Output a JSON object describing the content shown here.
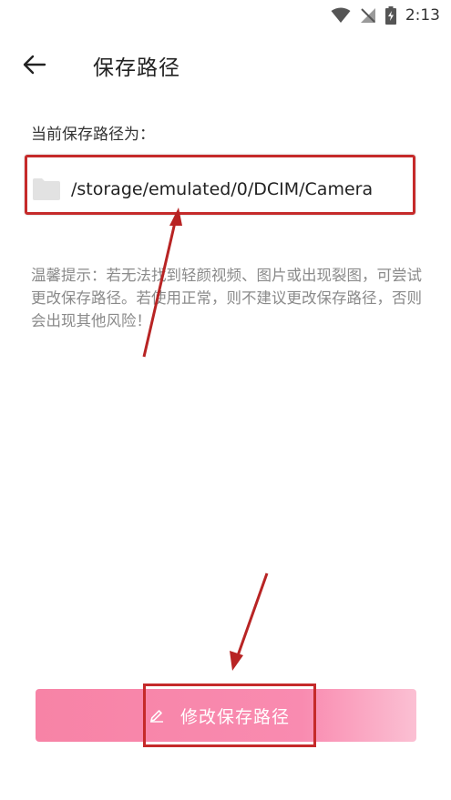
{
  "status_bar": {
    "time": "2:13",
    "icons": [
      "wifi-icon",
      "signal-off-icon",
      "battery-charging-icon"
    ]
  },
  "header": {
    "back_icon": "arrow-left-icon",
    "title": "保存路径"
  },
  "path_section": {
    "label": "当前保存路径为：",
    "folder_icon": "folder-icon",
    "path": "/storage/emulated/0/DCIM/Camera"
  },
  "tip": "温馨提示：若无法找到轻颜视频、图片或出现裂图，可尝试更改保存路径。若使用正常，则不建议更改保存路径，否则会出现其他风险！",
  "modify_button": {
    "icon": "edit-icon",
    "label": "修改保存路径"
  },
  "colors": {
    "accent": "#f783a6",
    "highlight": "#c52a2a"
  }
}
